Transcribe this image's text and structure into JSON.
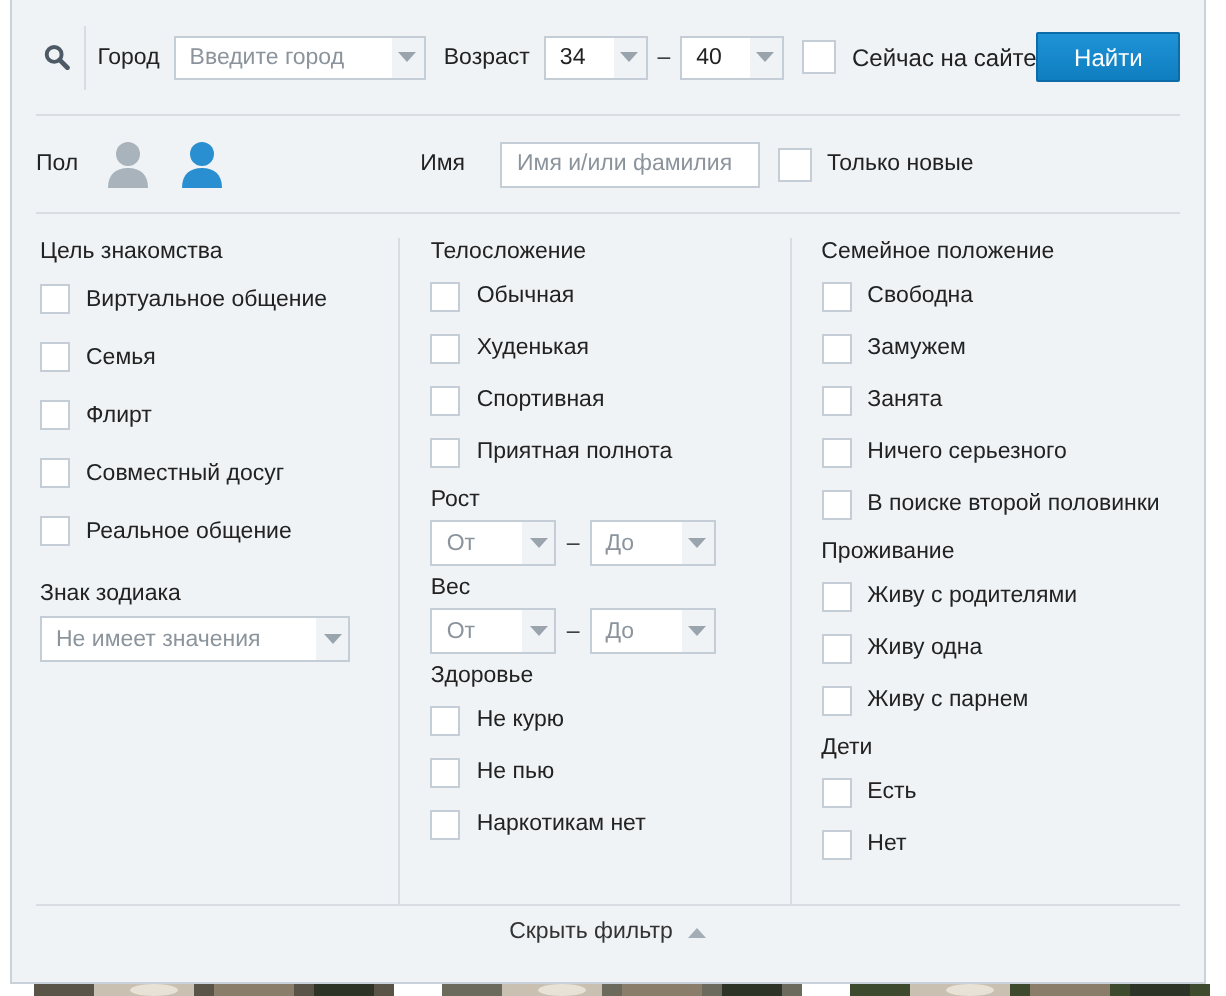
{
  "search": {
    "city": {
      "label": "Город",
      "placeholder": "Введите город"
    },
    "age": {
      "label": "Возраст",
      "from": "34",
      "to": "40",
      "dash": "–"
    },
    "online": {
      "label": "Сейчас на сайте",
      "checked": false
    },
    "button": "Найти"
  },
  "profile": {
    "gender": {
      "label": "Пол",
      "options": [
        {
          "selected": false
        },
        {
          "selected": true
        }
      ]
    },
    "name": {
      "label": "Имя",
      "placeholder": "Имя и/или фамилия"
    },
    "only_new": {
      "label": "Только новые",
      "checked": false
    }
  },
  "columns": [
    {
      "sections": [
        {
          "kind": "checkboxes",
          "title": "Цель знакомства",
          "items": [
            {
              "label": "Виртуальное общение",
              "checked": false
            },
            {
              "label": "Семья",
              "checked": false
            },
            {
              "label": "Флирт",
              "checked": false
            },
            {
              "label": "Совместный досуг",
              "checked": false
            },
            {
              "label": "Реальное общение",
              "checked": false
            }
          ]
        },
        {
          "kind": "select",
          "title": "Знак зодиака",
          "placeholder": "Не имеет значения"
        }
      ]
    },
    {
      "sections": [
        {
          "kind": "checkboxes",
          "title": "Телосложение",
          "items": [
            {
              "label": "Обычная",
              "checked": false
            },
            {
              "label": "Худенькая",
              "checked": false
            },
            {
              "label": "Спортивная",
              "checked": false
            },
            {
              "label": "Приятная полнота",
              "checked": false
            }
          ]
        },
        {
          "kind": "range",
          "title": "Рост",
          "from": "От",
          "to": "До",
          "dash": "–"
        },
        {
          "kind": "range",
          "title": "Вес",
          "from": "От",
          "to": "До",
          "dash": "–"
        },
        {
          "kind": "checkboxes",
          "title": "Здоровье",
          "items": [
            {
              "label": "Не курю",
              "checked": false
            },
            {
              "label": "Не пью",
              "checked": false
            },
            {
              "label": "Наркотикам нет",
              "checked": false
            }
          ]
        }
      ]
    },
    {
      "sections": [
        {
          "kind": "checkboxes",
          "title": "Семейное положение",
          "items": [
            {
              "label": "Свободна",
              "checked": false
            },
            {
              "label": "Замужем",
              "checked": false
            },
            {
              "label": "Занята",
              "checked": false
            },
            {
              "label": "Ничего серьезного",
              "checked": false
            },
            {
              "label": "В поиске второй половинки",
              "checked": false
            }
          ]
        },
        {
          "kind": "checkboxes",
          "title": "Проживание",
          "items": [
            {
              "label": "Живу с родителями",
              "checked": false
            },
            {
              "label": "Живу одна",
              "checked": false
            },
            {
              "label": "Живу с парнем",
              "checked": false
            }
          ]
        },
        {
          "kind": "checkboxes",
          "title": "Дети",
          "items": [
            {
              "label": "Есть",
              "checked": false
            },
            {
              "label": "Нет",
              "checked": false
            }
          ]
        }
      ]
    }
  ],
  "footer": {
    "toggle": "Скрыть фильтр"
  }
}
